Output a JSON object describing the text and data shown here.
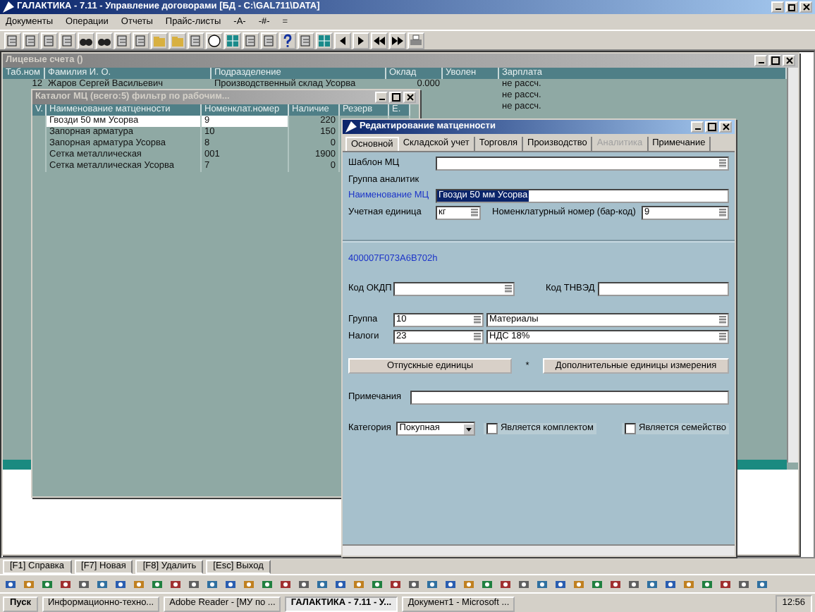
{
  "app_window": {
    "title": "ГАЛАКТИКА - 7.11 - Управление договорами [БД - C:\\GAL711\\DATA]"
  },
  "menu": [
    "Документы",
    "Операции",
    "Отчеты",
    "Прайс-листы",
    "-А-",
    "-#-",
    "="
  ],
  "accounts_window": {
    "title": "Лицевые счета ()",
    "columns": [
      "Таб.ном",
      "Фамилия И. О.",
      "Подразделение",
      "Оклад",
      "Уволен",
      "Зарплата"
    ],
    "rows": [
      {
        "number": "12",
        "name": "Жаров Сергей Васильевич",
        "department": "Производственный склад Усорва",
        "rate": "0.000",
        "salary": "не рассч."
      },
      {
        "salary": "не рассч."
      },
      {
        "salary": "не рассч."
      }
    ]
  },
  "catalog_window": {
    "title": "Каталог МЦ (всего:5) фильтр по рабочим...",
    "columns": [
      "V.",
      "Наименование матценности",
      "Номенклат.номер",
      "Наличие",
      "Резерв",
      "Е."
    ],
    "rows": [
      {
        "name": "Гвозди 50 мм  Усорва",
        "number": "9",
        "stock": "220",
        "selected": true
      },
      {
        "name": "Запорная арматура",
        "number": "10",
        "stock": "150",
        "selected": false
      },
      {
        "name": "Запорная арматура Усорва",
        "number": "8",
        "stock": "0",
        "selected": false
      },
      {
        "name": "Сетка металлическая",
        "number": "001",
        "stock": "1900",
        "selected": false
      },
      {
        "name": "Сетка металлическая Усорва",
        "number": "7",
        "stock": "0",
        "selected": false
      }
    ]
  },
  "edit_window": {
    "title": "Редактирование матценности",
    "tabs": [
      {
        "label": "Основной",
        "selected": true,
        "disabled": false
      },
      {
        "label": "Складской учет",
        "selected": false,
        "disabled": false
      },
      {
        "label": "Торговля",
        "selected": false,
        "disabled": false
      },
      {
        "label": "Производство",
        "selected": false,
        "disabled": false
      },
      {
        "label": "Аналитика",
        "selected": false,
        "disabled": true
      },
      {
        "label": "Примечание",
        "selected": false,
        "disabled": false
      }
    ],
    "template": {
      "label": "Шаблон МЦ"
    },
    "analytics_group": {
      "label": "Группа аналитик"
    },
    "name": {
      "label": "Наименование МЦ",
      "value": "Гвозди 50 мм  Усорва"
    },
    "unit": {
      "label": "Учетная единица",
      "value": "кг"
    },
    "barcode": {
      "label": "Номенклатурный номер (бар-код)",
      "value": "9"
    },
    "code": "400007F073A6B702h",
    "okdp": {
      "label": "Код ОКДП"
    },
    "tnved": {
      "label": "Код ТНВЭД"
    },
    "group": {
      "label": "Группа",
      "code": "10",
      "value": "Материалы"
    },
    "taxes": {
      "label": "Налоги",
      "code": "23",
      "value": "НДС 18%"
    },
    "buttons": [
      "Отпускные единицы",
      "Дополнительные единицы измерения"
    ],
    "marker": "*",
    "notes": {
      "label": "Примечания"
    },
    "category": {
      "label": "Категория",
      "value": "Покупная"
    },
    "checkboxes": [
      {
        "label": "Является комплектом",
        "checked": false
      },
      {
        "label": "Является семейство",
        "checked": false
      }
    ]
  },
  "fkeys": [
    "[F1] Справка",
    "[F7] Новая",
    "[F8] Удалить",
    "[Esc] Выход"
  ],
  "taskbar": {
    "start": "Пуск",
    "tasks": [
      {
        "label": "Информационно-техно...",
        "selected": false
      },
      {
        "label": "Adobe Reader - [МУ по ...",
        "selected": false
      },
      {
        "label": "ГАЛАКТИКА - 7.11 - У...",
        "selected": true
      },
      {
        "label": "Документ1 - Microsoft ...",
        "selected": false
      }
    ],
    "clock": "12:56"
  }
}
